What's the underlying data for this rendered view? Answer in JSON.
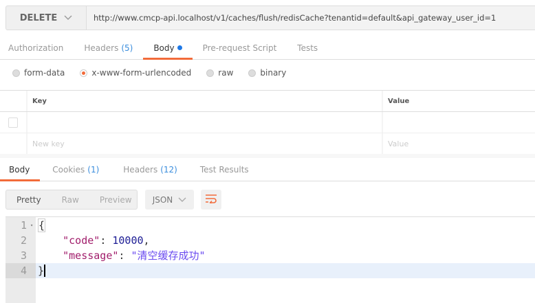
{
  "request": {
    "method": "DELETE",
    "url": "http://www.cmcp-api.localhost/v1/caches/flush/redisCache?tenantid=default&api_gateway_user_id=1"
  },
  "request_tabs": [
    {
      "label": "Authorization"
    },
    {
      "label": "Headers",
      "count": "(5)"
    },
    {
      "label": "Body",
      "active": true
    },
    {
      "label": "Pre-request Script"
    },
    {
      "label": "Tests"
    }
  ],
  "body_types": [
    {
      "label": "form-data"
    },
    {
      "label": "x-www-form-urlencoded",
      "selected": true
    },
    {
      "label": "raw"
    },
    {
      "label": "binary"
    }
  ],
  "params_table": {
    "headers": [
      "Key",
      "Value"
    ],
    "new_key_placeholder": "New key",
    "value_placeholder": "Value"
  },
  "response_tabs": [
    {
      "label": "Body",
      "active": true
    },
    {
      "label": "Cookies",
      "count": "(1)"
    },
    {
      "label": "Headers",
      "count": "(12)"
    },
    {
      "label": "Test Results"
    }
  ],
  "view_modes": [
    "Pretty",
    "Raw",
    "Preview"
  ],
  "format": "JSON",
  "response": {
    "line_numbers": [
      "1",
      "2",
      "3",
      "4"
    ],
    "code_key": "\"code\"",
    "code_value": "10000",
    "message_key": "\"message\"",
    "message_value": "\"清空缓存成功\""
  },
  "colors": {
    "accent": "#f26b3a",
    "count": "#3a8ddd"
  }
}
